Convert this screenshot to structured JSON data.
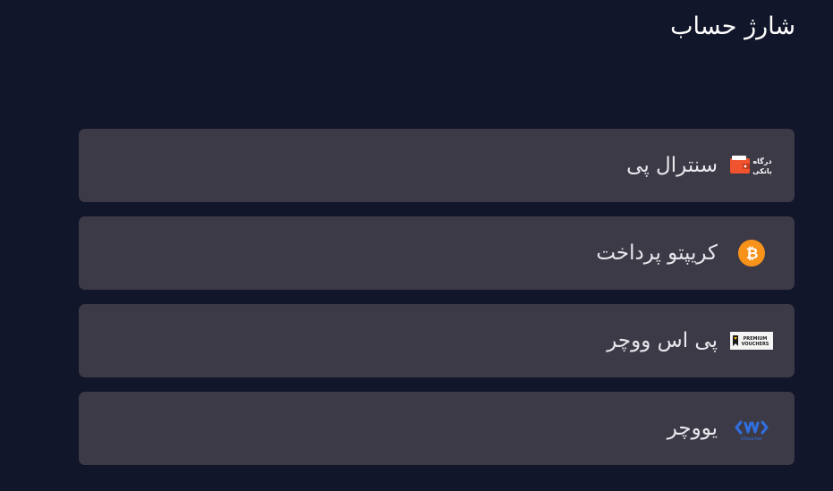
{
  "page": {
    "title": "شارژ حساب"
  },
  "methods": [
    {
      "label": "سنترال پی",
      "icon": "bank-gateway-wallet-icon",
      "icon_text": "درگاه\nبانکی"
    },
    {
      "label": "کریپتو پرداخت",
      "icon": "bitcoin-icon"
    },
    {
      "label": "پی اس ووچر",
      "icon": "premium-vouchers-logo-icon",
      "icon_text": "PREMIUM\nVOUCHERS"
    },
    {
      "label": "یووچر",
      "icon": "uvoucher-logo-icon",
      "icon_text": "UVoucher"
    }
  ],
  "colors": {
    "background": "#12162a",
    "card": "#3d3a48",
    "bitcoin": "#f7931a",
    "wallet": "#f0532d",
    "uvoucher": "#2f6fe0"
  }
}
